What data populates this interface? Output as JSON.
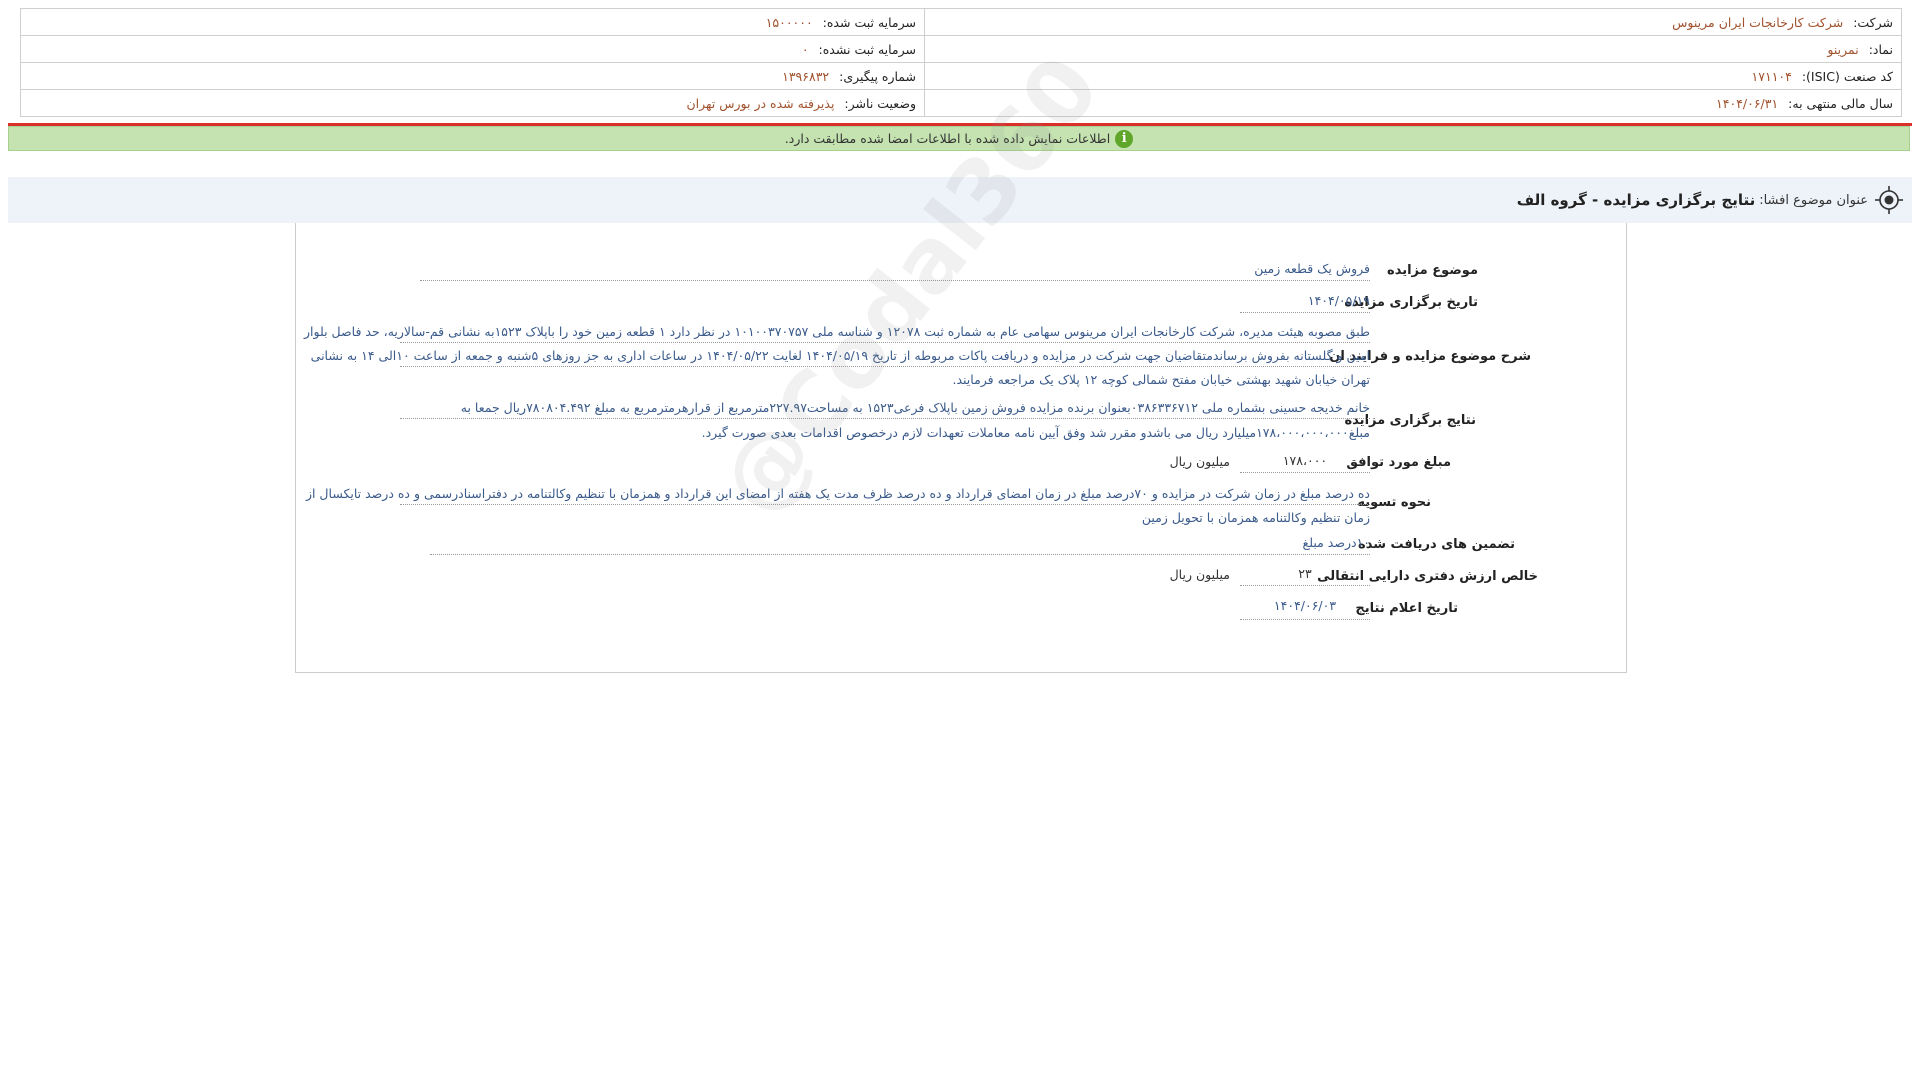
{
  "company_info": {
    "company_label": "شرکت:",
    "company_value": "شرکت کارخانجات ایران مرینوس",
    "symbol_label": "نماد:",
    "symbol_value": "نمرینو",
    "isic_label": "کد صنعت (ISIC):",
    "isic_value": "۱۷۱۱۰۴",
    "fiscal_label": "سال مالی منتهی به:",
    "fiscal_value": "۱۴۰۴/۰۶/۳۱",
    "reg_capital_label": "سرمایه ثبت شده:",
    "reg_capital_value": "۱۵۰۰۰۰۰",
    "unreg_capital_label": "سرمایه ثبت نشده:",
    "unreg_capital_value": "۰",
    "tracking_label": "شماره پیگیری:",
    "tracking_value": "۱۳۹۶۸۳۲",
    "status_label": "وضعیت ناشر:",
    "status_value": "پذیرفته شده در بورس تهران"
  },
  "status_bar": {
    "message": "اطلاعات نمایش داده شده با اطلاعات امضا شده مطابقت دارد.",
    "icon": "info-icon"
  },
  "title_bar": {
    "label": "عنوان موضوع افشا:",
    "value": "نتایج برگزاری مزایده - گروه الف",
    "icon": "target-icon"
  },
  "details": {
    "subject_label": "موضوع مزایده",
    "subject_value": "فروش یک قطعه زمین",
    "date_label": "تاریخ برگزاری مزایده",
    "date_value": "۱۴۰۴/۰۵/۱۹",
    "description_label": "شرح موضوع مزایده و فرایند ان",
    "description_lines": [
      "طبق مصوبه هیئت مدیره، شرکت کارخانجات ایران مرینوس سهامی عام به شماره ثبت ۱۲۰۷۸ و شناسه ملی ۱۰۱۰۰۳۷۰۷۵۷ در نظر دارد ۱ قطعه زمین خود را باپلاک ۱۵۲۳به نشانی قم-سالاریه، حد فاصل بلوار",
      "امین و گلستانه بفروش برساندمتقاضیان جهت شرکت در مزایده و دریافت پاکات مربوطه از تاریخ ۱۴۰۴/۰۵/۱۹ لغایت ۱۴۰۴/۰۵/۲۲ در ساعات اداری به جز روزهای ۵شنبه و جمعه از ساعت ۱۰الی ۱۴ به نشانی",
      "تهران خیابان شهید بهشتی خیابان مفتح شمالی کوچه ۱۲ پلاک یک مراجعه فرمایند."
    ],
    "results_label": "نتایج برگزاری مزایده",
    "results_lines": [
      "خانم خدیجه حسینی بشماره ملی ۰۳۸۶۳۳۶۷۱۲بعنوان برنده مزایده فروش زمین باپلاک فرعی۱۵۲۳ به مساحت۲۲۷.۹۷مترمربع از قرارهرمترمربع به مبلغ ۷۸۰۸۰۴.۴۹۲ریال جمعا به",
      "مبلغ۱۷۸،۰۰۰،۰۰۰،۰۰۰میلیارد ریال می باشدو مقرر شد وفق آیین نامه معاملات تعهدات لازم درخصوص اقدامات بعدی صورت گیرد."
    ],
    "amount_label": "مبلغ مورد توافق",
    "amount_value": "۱۷۸،۰۰۰",
    "amount_unit": "میلیون ریال",
    "settlement_label": "نحوه تسویه",
    "settlement_lines": [
      "ده درصد مبلغ در زمان شرکت در مزایده و ۷۰درصد مبلغ در زمان امضای قرارداد و ده درصد ظرف مدت یک هفته از امضای این قرارداد و همزمان با تنظیم وکالتنامه در دفتراسنادرسمی و ده درصد تایکسال از",
      "زمان تنظیم وکالتنامه همزمان با تحویل زمین"
    ],
    "guarantee_label": "تضمین های دریافت شده",
    "guarantee_value": "۱۰درصد مبلغ",
    "book_value_label": "خالص ارزش دفتری دارایی انتقالی",
    "book_value_value": "۲۳",
    "book_value_unit": "میلیون ریال",
    "announce_label": "تاریخ اعلام نتایج",
    "announce_value": "۱۴۰۴/۰۶/۰۳"
  },
  "watermark": "@Codal360"
}
